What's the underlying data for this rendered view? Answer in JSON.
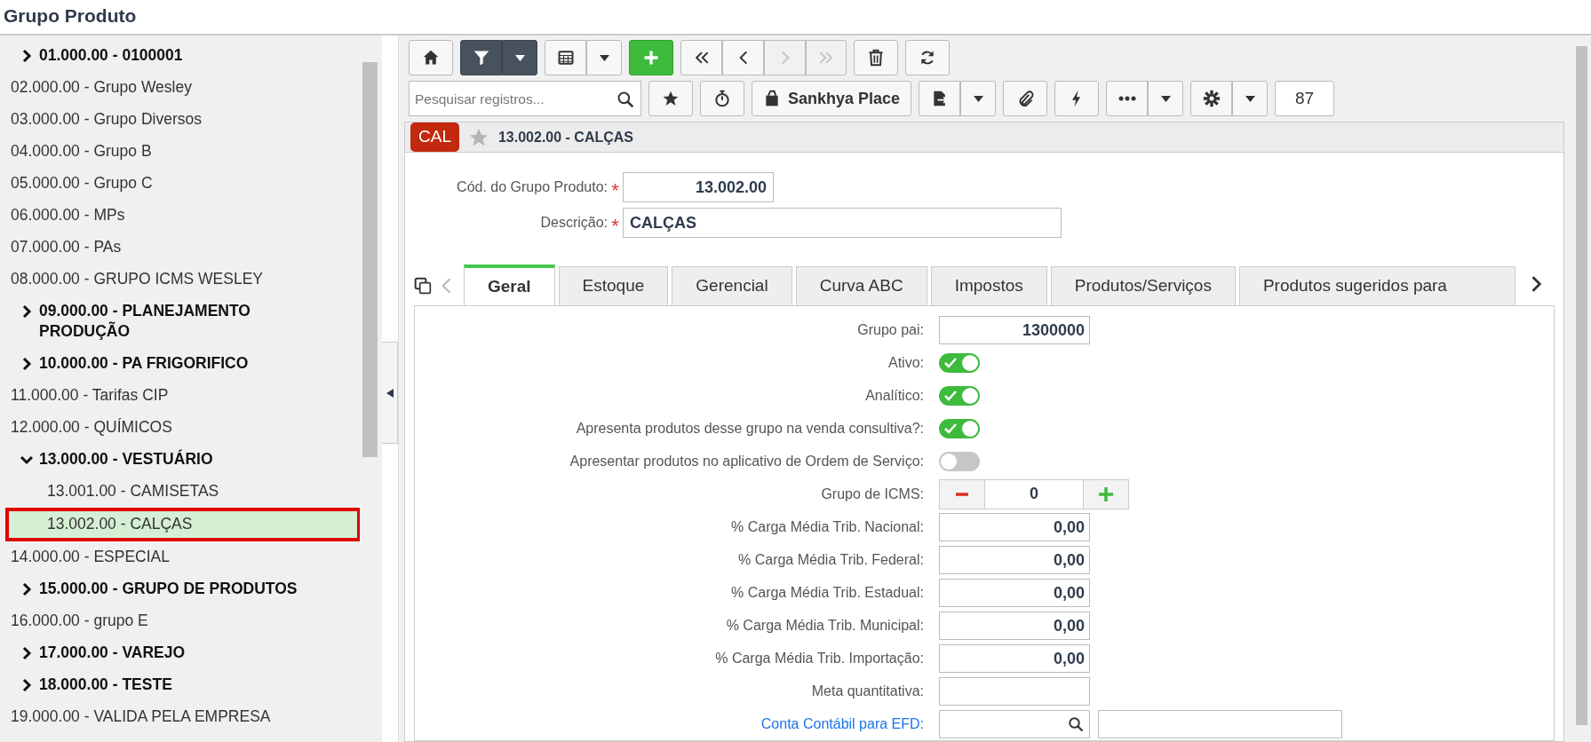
{
  "title": "Grupo Produto",
  "tree": [
    {
      "label": "01.000.00 - 0100001",
      "kind": "folder",
      "expanded": false,
      "selected": false
    },
    {
      "label": "02.000.00 - Grupo Wesley",
      "kind": "leaf",
      "selected": false
    },
    {
      "label": "03.000.00 - Grupo Diversos",
      "kind": "leaf",
      "selected": false
    },
    {
      "label": "04.000.00 - Grupo B",
      "kind": "leaf",
      "selected": false
    },
    {
      "label": "05.000.00 - Grupo C",
      "kind": "leaf",
      "selected": false
    },
    {
      "label": "06.000.00 - MPs",
      "kind": "leaf",
      "selected": false
    },
    {
      "label": "07.000.00 - PAs",
      "kind": "leaf",
      "selected": false
    },
    {
      "label": "08.000.00 - GRUPO ICMS WESLEY",
      "kind": "leaf",
      "selected": false
    },
    {
      "label": "09.000.00 - PLANEJAMENTO PRODUÇÃO",
      "kind": "folder",
      "expanded": false,
      "selected": false
    },
    {
      "label": "10.000.00 - PA FRIGORIFICO",
      "kind": "folder",
      "expanded": false,
      "selected": false
    },
    {
      "label": "11.000.00 - Tarifas CIP",
      "kind": "leaf",
      "selected": false
    },
    {
      "label": "12.000.00 - QUÍMICOS",
      "kind": "leaf",
      "selected": false
    },
    {
      "label": "13.000.00 - VESTUÁRIO",
      "kind": "folder",
      "expanded": true,
      "selected": false,
      "children": [
        {
          "label": "13.001.00 - CAMISETAS",
          "kind": "leaf",
          "selected": false
        },
        {
          "label": "13.002.00 - CALÇAS",
          "kind": "leaf",
          "selected": true
        }
      ]
    },
    {
      "label": "14.000.00 - ESPECIAL",
      "kind": "leaf",
      "selected": false
    },
    {
      "label": "15.000.00 - GRUPO DE PRODUTOS",
      "kind": "folder",
      "expanded": false,
      "selected": false
    },
    {
      "label": "16.000.00 - grupo E",
      "kind": "leaf",
      "selected": false
    },
    {
      "label": "17.000.00 - VAREJO",
      "kind": "folder",
      "expanded": false,
      "selected": false
    },
    {
      "label": "18.000.00 - TESTE",
      "kind": "folder",
      "expanded": false,
      "selected": false
    },
    {
      "label": "19.000.00 - VALIDA PELA EMPRESA",
      "kind": "leaf",
      "selected": false
    }
  ],
  "toolbar": {
    "row1": [
      {
        "kind": "icon"
      },
      {
        "kind": "split",
        "active": true
      },
      {
        "kind": "split",
        "active": false
      },
      {
        "kind": "icon"
      },
      {
        "kind": "group",
        "buttons": [
          {
            "disabled": false
          },
          {
            "disabled": false
          },
          {
            "disabled": true
          },
          {
            "disabled": true
          }
        ]
      },
      {
        "kind": "icon"
      },
      {
        "kind": "icon"
      }
    ],
    "row2": [
      {
        "kind": "search",
        "placeholder": "Pesquisar registros..."
      },
      {
        "kind": "icon"
      },
      {
        "kind": "icon"
      },
      {
        "kind": "text",
        "label": "Sankhya Place"
      },
      {
        "kind": "split"
      },
      {
        "kind": "icon"
      },
      {
        "kind": "icon"
      },
      {
        "kind": "split"
      },
      {
        "kind": "split"
      },
      {
        "kind": "counter",
        "label": "87"
      }
    ]
  },
  "record": {
    "badge": "CAL",
    "favorite": false,
    "title": "13.002.00 - CALÇAS"
  },
  "header_fields": [
    {
      "kind": "number",
      "label": "Cód. do Grupo Produto:",
      "required_mark": "*",
      "value": "13.002.00"
    },
    {
      "kind": "text",
      "label": "Descrição:",
      "required_mark": "*",
      "value": "CALÇAS"
    }
  ],
  "tabs": [
    {
      "label": "Geral",
      "selected": true
    },
    {
      "label": "Estoque",
      "selected": false
    },
    {
      "label": "Gerencial",
      "selected": false
    },
    {
      "label": "Curva ABC",
      "selected": false
    },
    {
      "label": "Impostos",
      "selected": false
    },
    {
      "label": "Produtos/Serviços",
      "selected": false
    },
    {
      "label": "Produtos sugeridos para",
      "selected": false
    }
  ],
  "fields": [
    {
      "kind": "number",
      "label": "Grupo pai:",
      "value": "1300000"
    },
    {
      "kind": "toggle",
      "label": "Ativo:",
      "on": true
    },
    {
      "kind": "toggle",
      "label": "Analítico:",
      "on": true
    },
    {
      "kind": "toggle",
      "label": "Apresenta produtos desse grupo na venda consultiva?:",
      "on": true
    },
    {
      "kind": "toggle",
      "label": "Apresentar produtos no aplicativo de Ordem de Serviço:",
      "on": false
    },
    {
      "kind": "stepper",
      "label": "Grupo de ICMS:",
      "value": "0"
    },
    {
      "kind": "number",
      "label": "% Carga Média Trib. Nacional:",
      "value": "0,00"
    },
    {
      "kind": "number",
      "label": "% Carga Média Trib. Federal:",
      "value": "0,00"
    },
    {
      "kind": "number",
      "label": "% Carga Média Trib. Estadual:",
      "value": "0,00"
    },
    {
      "kind": "number",
      "label": "% Carga Média Trib. Municipal:",
      "value": "0,00"
    },
    {
      "kind": "number",
      "label": "% Carga Média Trib. Importação:",
      "value": "0,00"
    },
    {
      "kind": "number",
      "label": "Meta quantitativa:"
    },
    {
      "kind": "lookup",
      "label": "Conta Contábil para EFD:",
      "link": true
    }
  ]
}
